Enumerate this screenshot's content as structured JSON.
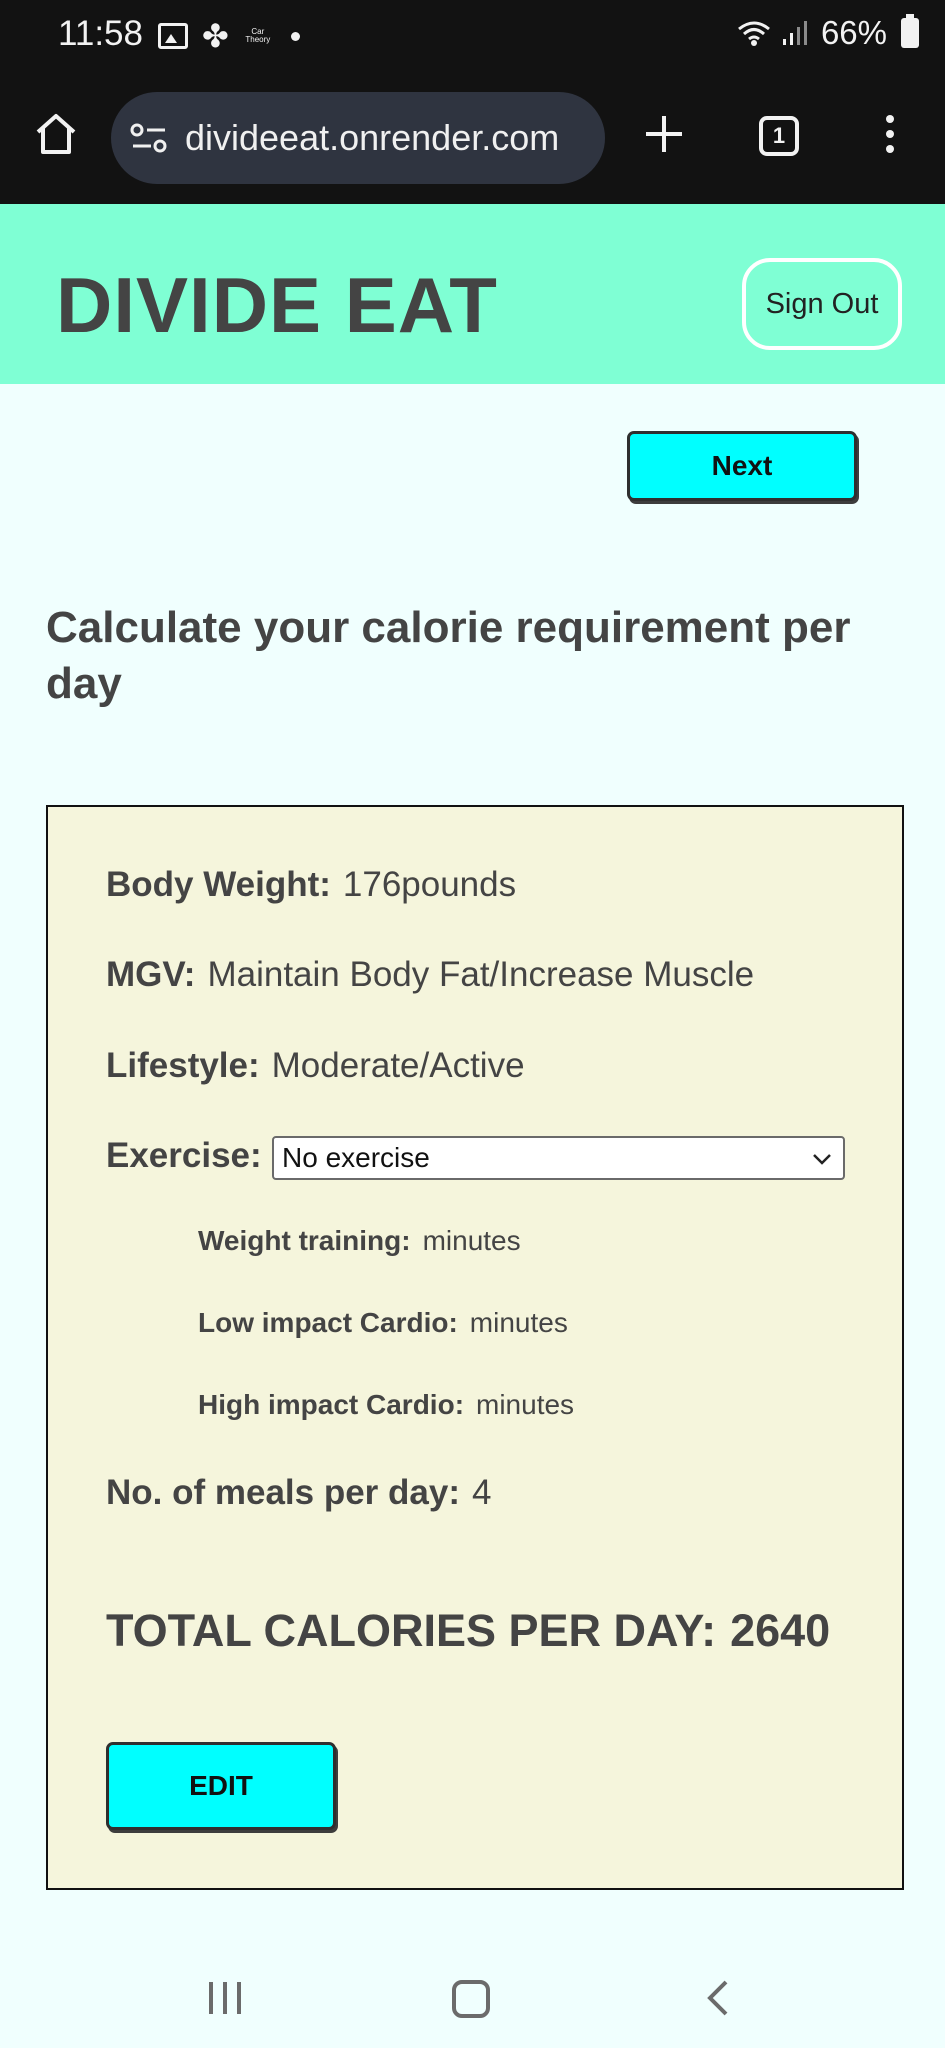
{
  "status_bar": {
    "time": "11:58",
    "app_icon_text": "Car Theory",
    "battery": "66%"
  },
  "browser": {
    "url": "divideeat.onrender.com",
    "tab_count": "1"
  },
  "header": {
    "brand": "DIVIDE EAT",
    "sign_out": "Sign Out"
  },
  "actions": {
    "next": "Next",
    "edit": "EDIT"
  },
  "page_title": "Calculate your calorie requirement per day",
  "details": {
    "body_weight_label": "Body Weight:",
    "body_weight_value": "176pounds",
    "mgv_label": "MGV:",
    "mgv_value": "Maintain Body Fat/Increase Muscle",
    "lifestyle_label": "Lifestyle:",
    "lifestyle_value": "Moderate/Active",
    "exercise_label": "Exercise:",
    "exercise_selected": "No exercise",
    "weight_training_label": "Weight training:",
    "weight_training_value": "minutes",
    "low_cardio_label": "Low impact Cardio:",
    "low_cardio_value": "minutes",
    "high_cardio_label": "High impact Cardio:",
    "high_cardio_value": "minutes",
    "meals_label": "No. of meals per day:",
    "meals_value": "4",
    "total_label": "TOTAL CALORIES PER DAY:",
    "total_value": "2640"
  },
  "colors": {
    "header_bg": "#7fffd4",
    "button_bg": "#00ffff",
    "card_bg": "#f5f5dc",
    "page_bg": "#f0fffe"
  }
}
